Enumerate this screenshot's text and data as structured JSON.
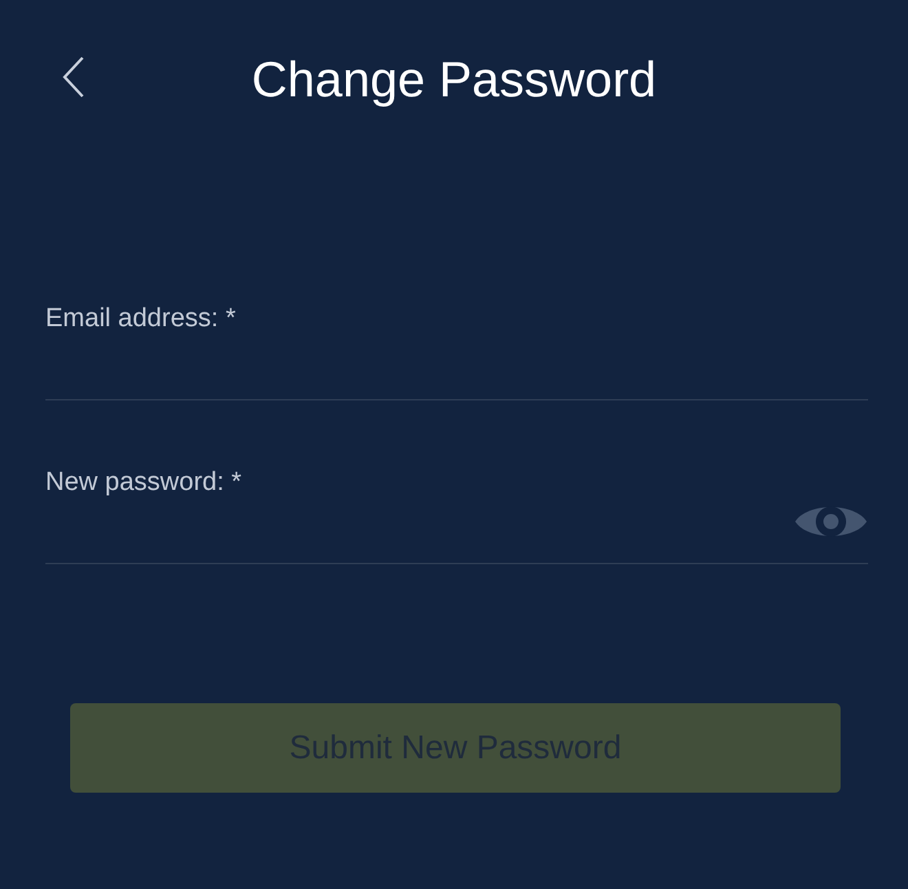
{
  "header": {
    "title": "Change Password"
  },
  "fields": [
    {
      "label": "Email address: *",
      "kind": "text"
    },
    {
      "label": "New password: *",
      "kind": "password"
    }
  ],
  "submit": {
    "label": "Submit New Password",
    "disabled": true
  }
}
